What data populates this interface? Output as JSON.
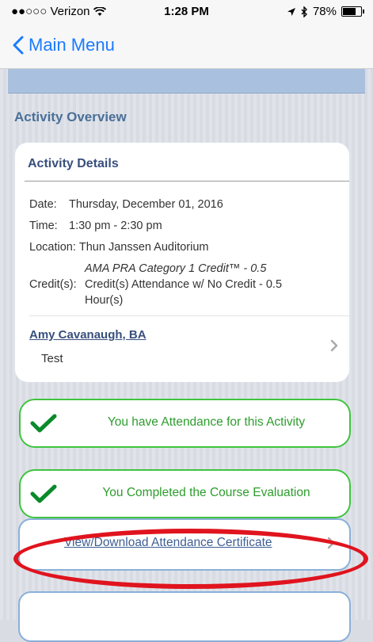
{
  "status_bar": {
    "carrier": "●●○○○ Verizon",
    "time": "1:28 PM",
    "battery": "78%",
    "battery_level": 0.78
  },
  "nav": {
    "back_label": "Main Menu"
  },
  "section_title": "Activity Overview",
  "details": {
    "title": "Activity Details",
    "date_label": "Date:",
    "date_value": "Thursday, December 01, 2016",
    "time_label": "Time:",
    "time_value": "1:30 pm - 2:30 pm",
    "location_label": "Location:",
    "location_value": "Thun Janssen Auditorium",
    "credit_label": "Credit(s):",
    "credit_line1": "AMA PRA Category 1 Credit™ - 0.5",
    "credit_line2": "Credit(s) Attendance w/ No Credit - 0.5 Hour(s)"
  },
  "presenter": {
    "name": "Amy Cavanaugh, BA",
    "subtitle": "Test"
  },
  "statuses": [
    {
      "text": "You have Attendance for this Activity"
    },
    {
      "text": "You Completed the Course Evaluation"
    }
  ],
  "certificate": {
    "label": "View/Download Attendance Certificate"
  },
  "colors": {
    "ios_blue": "#1a7bff",
    "success_green": "#3fc43f",
    "annotation_red": "#e0141e"
  }
}
